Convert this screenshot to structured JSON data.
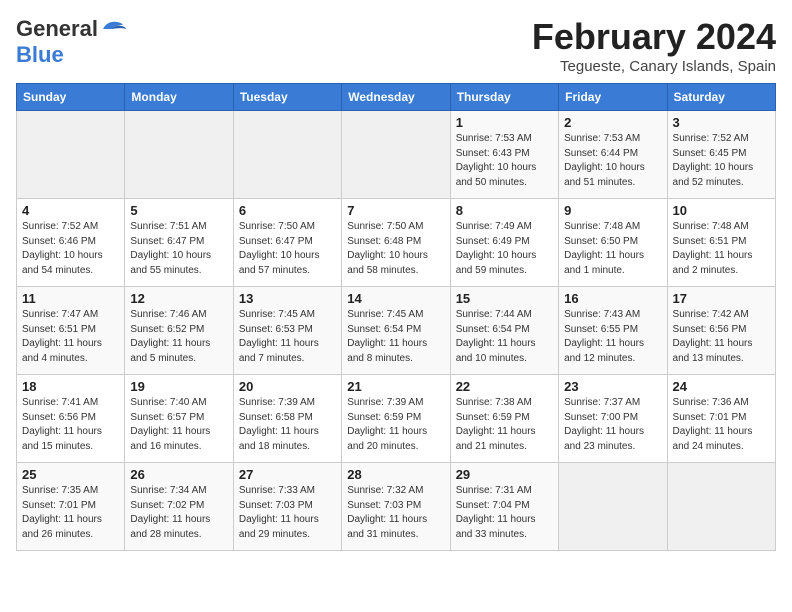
{
  "logo": {
    "general": "General",
    "blue": "Blue"
  },
  "header": {
    "title": "February 2024",
    "subtitle": "Tegueste, Canary Islands, Spain"
  },
  "days_of_week": [
    "Sunday",
    "Monday",
    "Tuesday",
    "Wednesday",
    "Thursday",
    "Friday",
    "Saturday"
  ],
  "weeks": [
    [
      {
        "day": "",
        "info": ""
      },
      {
        "day": "",
        "info": ""
      },
      {
        "day": "",
        "info": ""
      },
      {
        "day": "",
        "info": ""
      },
      {
        "day": "1",
        "info": "Sunrise: 7:53 AM\nSunset: 6:43 PM\nDaylight: 10 hours\nand 50 minutes."
      },
      {
        "day": "2",
        "info": "Sunrise: 7:53 AM\nSunset: 6:44 PM\nDaylight: 10 hours\nand 51 minutes."
      },
      {
        "day": "3",
        "info": "Sunrise: 7:52 AM\nSunset: 6:45 PM\nDaylight: 10 hours\nand 52 minutes."
      }
    ],
    [
      {
        "day": "4",
        "info": "Sunrise: 7:52 AM\nSunset: 6:46 PM\nDaylight: 10 hours\nand 54 minutes."
      },
      {
        "day": "5",
        "info": "Sunrise: 7:51 AM\nSunset: 6:47 PM\nDaylight: 10 hours\nand 55 minutes."
      },
      {
        "day": "6",
        "info": "Sunrise: 7:50 AM\nSunset: 6:47 PM\nDaylight: 10 hours\nand 57 minutes."
      },
      {
        "day": "7",
        "info": "Sunrise: 7:50 AM\nSunset: 6:48 PM\nDaylight: 10 hours\nand 58 minutes."
      },
      {
        "day": "8",
        "info": "Sunrise: 7:49 AM\nSunset: 6:49 PM\nDaylight: 10 hours\nand 59 minutes."
      },
      {
        "day": "9",
        "info": "Sunrise: 7:48 AM\nSunset: 6:50 PM\nDaylight: 11 hours\nand 1 minute."
      },
      {
        "day": "10",
        "info": "Sunrise: 7:48 AM\nSunset: 6:51 PM\nDaylight: 11 hours\nand 2 minutes."
      }
    ],
    [
      {
        "day": "11",
        "info": "Sunrise: 7:47 AM\nSunset: 6:51 PM\nDaylight: 11 hours\nand 4 minutes."
      },
      {
        "day": "12",
        "info": "Sunrise: 7:46 AM\nSunset: 6:52 PM\nDaylight: 11 hours\nand 5 minutes."
      },
      {
        "day": "13",
        "info": "Sunrise: 7:45 AM\nSunset: 6:53 PM\nDaylight: 11 hours\nand 7 minutes."
      },
      {
        "day": "14",
        "info": "Sunrise: 7:45 AM\nSunset: 6:54 PM\nDaylight: 11 hours\nand 8 minutes."
      },
      {
        "day": "15",
        "info": "Sunrise: 7:44 AM\nSunset: 6:54 PM\nDaylight: 11 hours\nand 10 minutes."
      },
      {
        "day": "16",
        "info": "Sunrise: 7:43 AM\nSunset: 6:55 PM\nDaylight: 11 hours\nand 12 minutes."
      },
      {
        "day": "17",
        "info": "Sunrise: 7:42 AM\nSunset: 6:56 PM\nDaylight: 11 hours\nand 13 minutes."
      }
    ],
    [
      {
        "day": "18",
        "info": "Sunrise: 7:41 AM\nSunset: 6:56 PM\nDaylight: 11 hours\nand 15 minutes."
      },
      {
        "day": "19",
        "info": "Sunrise: 7:40 AM\nSunset: 6:57 PM\nDaylight: 11 hours\nand 16 minutes."
      },
      {
        "day": "20",
        "info": "Sunrise: 7:39 AM\nSunset: 6:58 PM\nDaylight: 11 hours\nand 18 minutes."
      },
      {
        "day": "21",
        "info": "Sunrise: 7:39 AM\nSunset: 6:59 PM\nDaylight: 11 hours\nand 20 minutes."
      },
      {
        "day": "22",
        "info": "Sunrise: 7:38 AM\nSunset: 6:59 PM\nDaylight: 11 hours\nand 21 minutes."
      },
      {
        "day": "23",
        "info": "Sunrise: 7:37 AM\nSunset: 7:00 PM\nDaylight: 11 hours\nand 23 minutes."
      },
      {
        "day": "24",
        "info": "Sunrise: 7:36 AM\nSunset: 7:01 PM\nDaylight: 11 hours\nand 24 minutes."
      }
    ],
    [
      {
        "day": "25",
        "info": "Sunrise: 7:35 AM\nSunset: 7:01 PM\nDaylight: 11 hours\nand 26 minutes."
      },
      {
        "day": "26",
        "info": "Sunrise: 7:34 AM\nSunset: 7:02 PM\nDaylight: 11 hours\nand 28 minutes."
      },
      {
        "day": "27",
        "info": "Sunrise: 7:33 AM\nSunset: 7:03 PM\nDaylight: 11 hours\nand 29 minutes."
      },
      {
        "day": "28",
        "info": "Sunrise: 7:32 AM\nSunset: 7:03 PM\nDaylight: 11 hours\nand 31 minutes."
      },
      {
        "day": "29",
        "info": "Sunrise: 7:31 AM\nSunset: 7:04 PM\nDaylight: 11 hours\nand 33 minutes."
      },
      {
        "day": "",
        "info": ""
      },
      {
        "day": "",
        "info": ""
      }
    ]
  ]
}
